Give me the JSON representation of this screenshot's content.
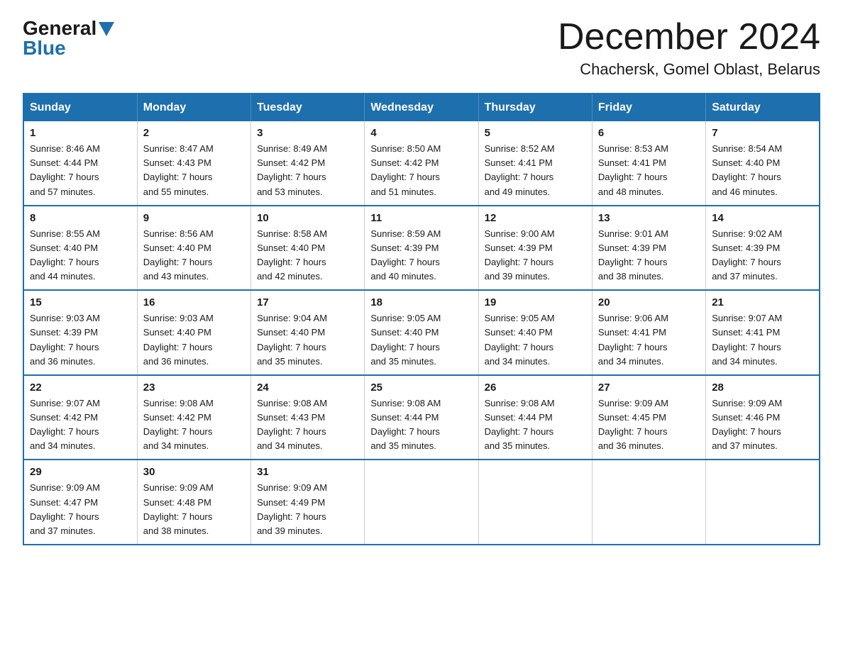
{
  "logo": {
    "general": "General",
    "blue": "Blue"
  },
  "title": "December 2024",
  "subtitle": "Chachersk, Gomel Oblast, Belarus",
  "weekdays": [
    "Sunday",
    "Monday",
    "Tuesday",
    "Wednesday",
    "Thursday",
    "Friday",
    "Saturday"
  ],
  "weeks": [
    [
      {
        "day": "1",
        "sunrise": "Sunrise: 8:46 AM",
        "sunset": "Sunset: 4:44 PM",
        "daylight": "Daylight: 7 hours",
        "minutes": "and 57 minutes."
      },
      {
        "day": "2",
        "sunrise": "Sunrise: 8:47 AM",
        "sunset": "Sunset: 4:43 PM",
        "daylight": "Daylight: 7 hours",
        "minutes": "and 55 minutes."
      },
      {
        "day": "3",
        "sunrise": "Sunrise: 8:49 AM",
        "sunset": "Sunset: 4:42 PM",
        "daylight": "Daylight: 7 hours",
        "minutes": "and 53 minutes."
      },
      {
        "day": "4",
        "sunrise": "Sunrise: 8:50 AM",
        "sunset": "Sunset: 4:42 PM",
        "daylight": "Daylight: 7 hours",
        "minutes": "and 51 minutes."
      },
      {
        "day": "5",
        "sunrise": "Sunrise: 8:52 AM",
        "sunset": "Sunset: 4:41 PM",
        "daylight": "Daylight: 7 hours",
        "minutes": "and 49 minutes."
      },
      {
        "day": "6",
        "sunrise": "Sunrise: 8:53 AM",
        "sunset": "Sunset: 4:41 PM",
        "daylight": "Daylight: 7 hours",
        "minutes": "and 48 minutes."
      },
      {
        "day": "7",
        "sunrise": "Sunrise: 8:54 AM",
        "sunset": "Sunset: 4:40 PM",
        "daylight": "Daylight: 7 hours",
        "minutes": "and 46 minutes."
      }
    ],
    [
      {
        "day": "8",
        "sunrise": "Sunrise: 8:55 AM",
        "sunset": "Sunset: 4:40 PM",
        "daylight": "Daylight: 7 hours",
        "minutes": "and 44 minutes."
      },
      {
        "day": "9",
        "sunrise": "Sunrise: 8:56 AM",
        "sunset": "Sunset: 4:40 PM",
        "daylight": "Daylight: 7 hours",
        "minutes": "and 43 minutes."
      },
      {
        "day": "10",
        "sunrise": "Sunrise: 8:58 AM",
        "sunset": "Sunset: 4:40 PM",
        "daylight": "Daylight: 7 hours",
        "minutes": "and 42 minutes."
      },
      {
        "day": "11",
        "sunrise": "Sunrise: 8:59 AM",
        "sunset": "Sunset: 4:39 PM",
        "daylight": "Daylight: 7 hours",
        "minutes": "and 40 minutes."
      },
      {
        "day": "12",
        "sunrise": "Sunrise: 9:00 AM",
        "sunset": "Sunset: 4:39 PM",
        "daylight": "Daylight: 7 hours",
        "minutes": "and 39 minutes."
      },
      {
        "day": "13",
        "sunrise": "Sunrise: 9:01 AM",
        "sunset": "Sunset: 4:39 PM",
        "daylight": "Daylight: 7 hours",
        "minutes": "and 38 minutes."
      },
      {
        "day": "14",
        "sunrise": "Sunrise: 9:02 AM",
        "sunset": "Sunset: 4:39 PM",
        "daylight": "Daylight: 7 hours",
        "minutes": "and 37 minutes."
      }
    ],
    [
      {
        "day": "15",
        "sunrise": "Sunrise: 9:03 AM",
        "sunset": "Sunset: 4:39 PM",
        "daylight": "Daylight: 7 hours",
        "minutes": "and 36 minutes."
      },
      {
        "day": "16",
        "sunrise": "Sunrise: 9:03 AM",
        "sunset": "Sunset: 4:40 PM",
        "daylight": "Daylight: 7 hours",
        "minutes": "and 36 minutes."
      },
      {
        "day": "17",
        "sunrise": "Sunrise: 9:04 AM",
        "sunset": "Sunset: 4:40 PM",
        "daylight": "Daylight: 7 hours",
        "minutes": "and 35 minutes."
      },
      {
        "day": "18",
        "sunrise": "Sunrise: 9:05 AM",
        "sunset": "Sunset: 4:40 PM",
        "daylight": "Daylight: 7 hours",
        "minutes": "and 35 minutes."
      },
      {
        "day": "19",
        "sunrise": "Sunrise: 9:05 AM",
        "sunset": "Sunset: 4:40 PM",
        "daylight": "Daylight: 7 hours",
        "minutes": "and 34 minutes."
      },
      {
        "day": "20",
        "sunrise": "Sunrise: 9:06 AM",
        "sunset": "Sunset: 4:41 PM",
        "daylight": "Daylight: 7 hours",
        "minutes": "and 34 minutes."
      },
      {
        "day": "21",
        "sunrise": "Sunrise: 9:07 AM",
        "sunset": "Sunset: 4:41 PM",
        "daylight": "Daylight: 7 hours",
        "minutes": "and 34 minutes."
      }
    ],
    [
      {
        "day": "22",
        "sunrise": "Sunrise: 9:07 AM",
        "sunset": "Sunset: 4:42 PM",
        "daylight": "Daylight: 7 hours",
        "minutes": "and 34 minutes."
      },
      {
        "day": "23",
        "sunrise": "Sunrise: 9:08 AM",
        "sunset": "Sunset: 4:42 PM",
        "daylight": "Daylight: 7 hours",
        "minutes": "and 34 minutes."
      },
      {
        "day": "24",
        "sunrise": "Sunrise: 9:08 AM",
        "sunset": "Sunset: 4:43 PM",
        "daylight": "Daylight: 7 hours",
        "minutes": "and 34 minutes."
      },
      {
        "day": "25",
        "sunrise": "Sunrise: 9:08 AM",
        "sunset": "Sunset: 4:44 PM",
        "daylight": "Daylight: 7 hours",
        "minutes": "and 35 minutes."
      },
      {
        "day": "26",
        "sunrise": "Sunrise: 9:08 AM",
        "sunset": "Sunset: 4:44 PM",
        "daylight": "Daylight: 7 hours",
        "minutes": "and 35 minutes."
      },
      {
        "day": "27",
        "sunrise": "Sunrise: 9:09 AM",
        "sunset": "Sunset: 4:45 PM",
        "daylight": "Daylight: 7 hours",
        "minutes": "and 36 minutes."
      },
      {
        "day": "28",
        "sunrise": "Sunrise: 9:09 AM",
        "sunset": "Sunset: 4:46 PM",
        "daylight": "Daylight: 7 hours",
        "minutes": "and 37 minutes."
      }
    ],
    [
      {
        "day": "29",
        "sunrise": "Sunrise: 9:09 AM",
        "sunset": "Sunset: 4:47 PM",
        "daylight": "Daylight: 7 hours",
        "minutes": "and 37 minutes."
      },
      {
        "day": "30",
        "sunrise": "Sunrise: 9:09 AM",
        "sunset": "Sunset: 4:48 PM",
        "daylight": "Daylight: 7 hours",
        "minutes": "and 38 minutes."
      },
      {
        "day": "31",
        "sunrise": "Sunrise: 9:09 AM",
        "sunset": "Sunset: 4:49 PM",
        "daylight": "Daylight: 7 hours",
        "minutes": "and 39 minutes."
      },
      null,
      null,
      null,
      null
    ]
  ],
  "colors": {
    "header_bg": "#1e6fad",
    "header_text": "#ffffff",
    "border": "#1e6fad",
    "text": "#1a1a1a",
    "logo_blue": "#1e6fad"
  }
}
